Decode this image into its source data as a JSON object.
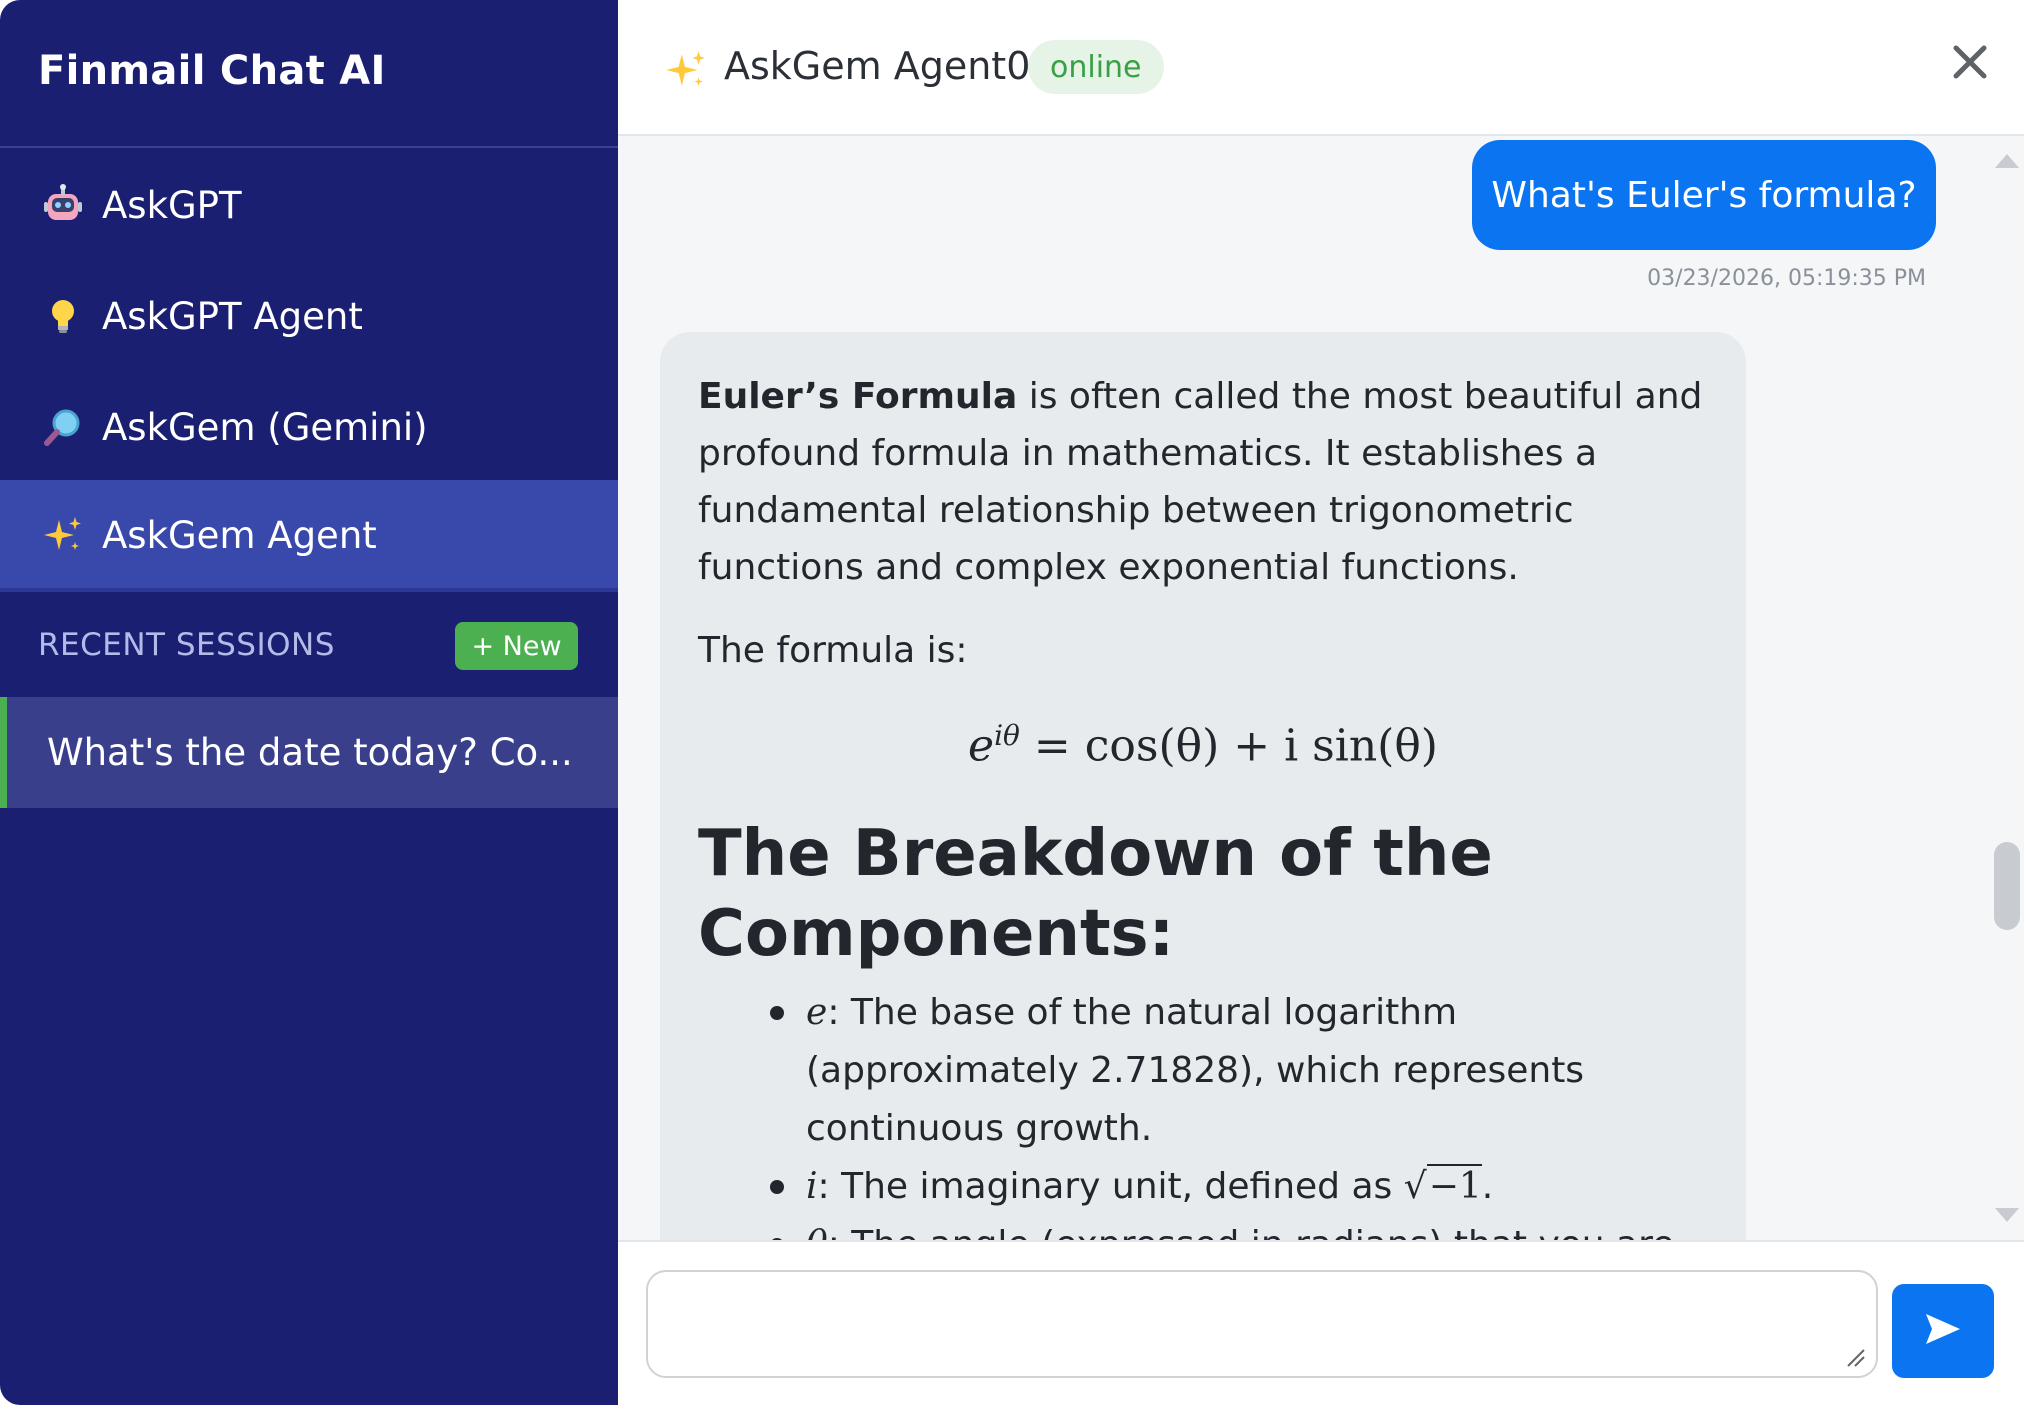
{
  "app": {
    "title": "Finmail Chat AI"
  },
  "sidebar": {
    "items": [
      {
        "label": "AskGPT",
        "icon": "robot-icon"
      },
      {
        "label": "AskGPT Agent",
        "icon": "lightbulb-icon"
      },
      {
        "label": "AskGem (Gemini)",
        "icon": "magnifier-icon"
      },
      {
        "label": "AskGem Agent",
        "icon": "sparkles-icon",
        "active": true
      }
    ],
    "recent_label": "RECENT SESSIONS",
    "new_label": "+ New",
    "sessions": [
      {
        "label": "What's the date today? Co..."
      }
    ]
  },
  "header": {
    "agent_name": "AskGem Agent0",
    "status": "online"
  },
  "chat": {
    "user_message": "What's Euler's formula?",
    "timestamp": "03/23/2026, 05:19:35 PM",
    "reply": {
      "bold_lead": "Euler’s Formula",
      "intro_rest": " is often called the most beautiful and profound formula in mathematics. It establishes a fundamental relationship between trigonometric functions and complex exponential functions.",
      "formula_intro": "The formula is:",
      "formula": {
        "base": "e",
        "exponent": "iθ",
        "rhs": "= cos(θ) + i sin(θ)"
      },
      "heading": "The Breakdown of the Components:",
      "components": [
        {
          "symbol": "e",
          "text": ": The base of the natural logarithm (approximately 2.71828), which represents continuous growth."
        },
        {
          "symbol": "i",
          "text": ": The imaginary unit, defined as ",
          "sqrt": "−1",
          "end": "."
        },
        {
          "symbol": "θ",
          "text": ": The angle (expressed in radians) that you are"
        }
      ]
    }
  },
  "input": {
    "placeholder": ""
  },
  "colors": {
    "sidebar": "#1a1f71",
    "sidebar_active": "#3949ab",
    "accent_blue": "#0b74f1",
    "accent_green": "#4caf50"
  }
}
